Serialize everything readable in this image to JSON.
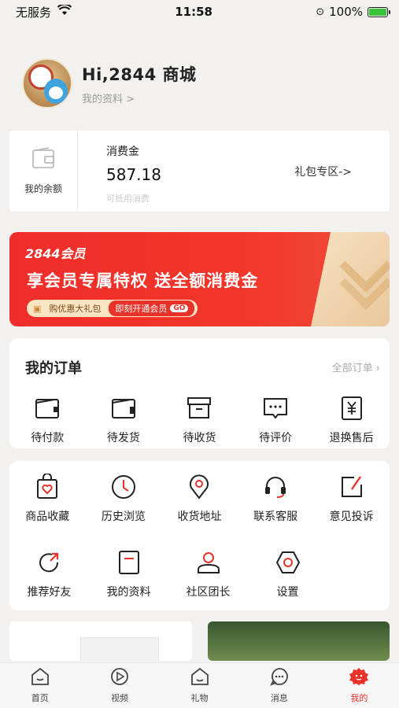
{
  "status_bar": {
    "carrier": "无服务",
    "time": "11:58",
    "battery": "100%"
  },
  "profile": {
    "name": "Hi,2844 商城",
    "link": "我的资料 >"
  },
  "wallet": {
    "balance_label": "我的余额",
    "title": "消费金",
    "amount": "587.18",
    "subtitle": "可抵用消费",
    "gift_link": "礼包专区->"
  },
  "vip": {
    "brand": "2844会员",
    "headline": "享会员专属特权  送全额消费金",
    "gift_label": "购优惠大礼包",
    "cta_label": "即刻开通会员",
    "go_label": "GO"
  },
  "orders": {
    "title": "我的订单",
    "all_link": "全部订单 ›",
    "items": [
      {
        "label": "待付款",
        "icon": "wallet-icon"
      },
      {
        "label": "待发货",
        "icon": "box-icon"
      },
      {
        "label": "待收货",
        "icon": "package-icon"
      },
      {
        "label": "待评价",
        "icon": "comment-icon"
      },
      {
        "label": "退换售后",
        "icon": "yen-icon"
      }
    ]
  },
  "services": {
    "row1": [
      {
        "label": "商品收藏",
        "icon": "heart-bag-icon"
      },
      {
        "label": "历史浏览",
        "icon": "clock-icon"
      },
      {
        "label": "收货地址",
        "icon": "location-icon"
      },
      {
        "label": "联系客服",
        "icon": "headset-icon"
      },
      {
        "label": "意见投诉",
        "icon": "edit-icon"
      }
    ],
    "row2": [
      {
        "label": "推荐好友",
        "icon": "share-icon"
      },
      {
        "label": "我的资料",
        "icon": "document-icon"
      },
      {
        "label": "社区团长",
        "icon": "user-icon"
      },
      {
        "label": "设置",
        "icon": "settings-icon"
      }
    ]
  },
  "tabs": [
    {
      "label": "首页",
      "icon": "home-icon",
      "active": false
    },
    {
      "label": "视频",
      "icon": "play-icon",
      "active": false
    },
    {
      "label": "礼物",
      "icon": "gift-icon",
      "active": false
    },
    {
      "label": "消息",
      "icon": "message-icon",
      "active": false
    },
    {
      "label": "我的",
      "icon": "profile-icon",
      "active": true
    }
  ],
  "colors": {
    "accent": "#e8322a",
    "background": "#f2f1ef"
  }
}
